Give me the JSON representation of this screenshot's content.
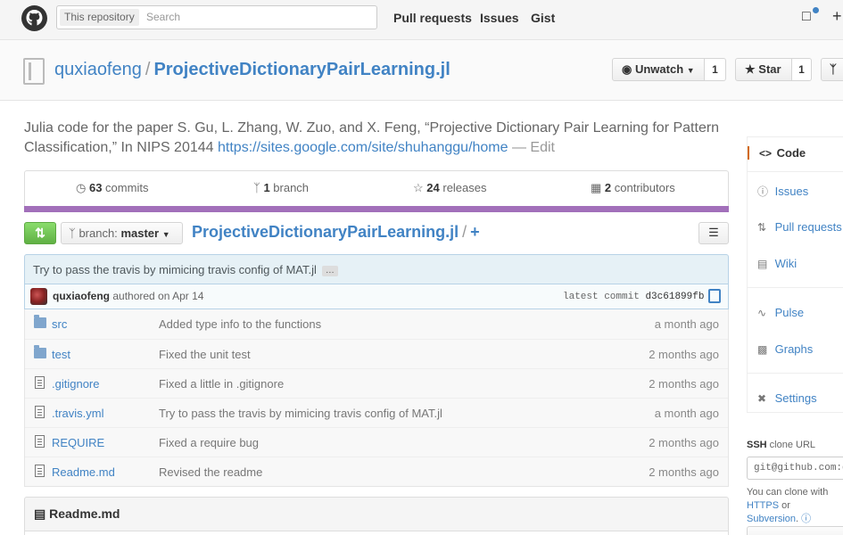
{
  "header": {
    "search_scope": "This repository",
    "search_placeholder": "Search",
    "nav": [
      "Pull requests",
      "Issues",
      "Gist"
    ]
  },
  "repo": {
    "owner": "quxiaofeng",
    "separator": "/",
    "name": "ProjectiveDictionaryPairLearning.jl",
    "unwatch_label": "Unwatch",
    "unwatch_count": "1",
    "star_label": "Star",
    "star_count": "1"
  },
  "description": {
    "text": "Julia code for the paper S. Gu, L. Zhang, W. Zuo, and X. Feng, “Projective Dictionary Pair Learning for Pattern Classification,” In NIPS 20144 ",
    "link": "https://sites.google.com/site/shuhanggu/home",
    "edit": " — Edit"
  },
  "summary": {
    "commits_count": "63",
    "commits_label": " commits",
    "branch_count": "1",
    "branch_label": " branch",
    "releases_count": "24",
    "releases_label": " releases",
    "contributors_count": "2",
    "contributors_label": " contributors"
  },
  "file_nav": {
    "branch_prefix": "branch:",
    "branch": "master",
    "path": "ProjectiveDictionaryPairLearning.jl",
    "slash": "/",
    "plus": "+"
  },
  "latest_commit": {
    "message": "Try to pass the travis by mimicing travis config of MAT.jl",
    "ellipsis": "…",
    "author": "quxiaofeng",
    "authored": " authored on Apr 14",
    "label": "latest commit",
    "sha": "d3c61899fb"
  },
  "files": [
    {
      "type": "dir",
      "name": "src",
      "message": "Added type info to the functions",
      "age": "a month ago"
    },
    {
      "type": "dir",
      "name": "test",
      "message": "Fixed the unit test",
      "age": "2 months ago"
    },
    {
      "type": "file",
      "name": ".gitignore",
      "message": "Fixed a little in .gitignore",
      "age": "2 months ago"
    },
    {
      "type": "file",
      "name": ".travis.yml",
      "message": "Try to pass the travis by mimicing travis config of MAT.jl",
      "age": "a month ago"
    },
    {
      "type": "file",
      "name": "REQUIRE",
      "message": "Fixed a require bug",
      "age": "2 months ago"
    },
    {
      "type": "file",
      "name": "Readme.md",
      "message": "Revised the readme",
      "age": "2 months ago"
    }
  ],
  "readme": {
    "title": "Readme.md"
  },
  "sidebar": {
    "items": [
      "Code",
      "Issues",
      "Pull requests",
      "Wiki",
      "Pulse",
      "Graphs",
      "Settings"
    ],
    "clone_proto": "SSH",
    "clone_label": " clone URL",
    "clone_url": "git@github.com:quxiaofeng/ProjectiveDictionaryPairLearning.jl.git",
    "clone_help_1": "You can clone with ",
    "clone_help_link1": "HTTPS",
    "clone_help_2": " or ",
    "clone_help_link2": "Subversion",
    "clone_help_3": ". "
  },
  "colors": {
    "link": "#4183c4",
    "language_bar": "#a270ba",
    "accent": "#d26911"
  }
}
